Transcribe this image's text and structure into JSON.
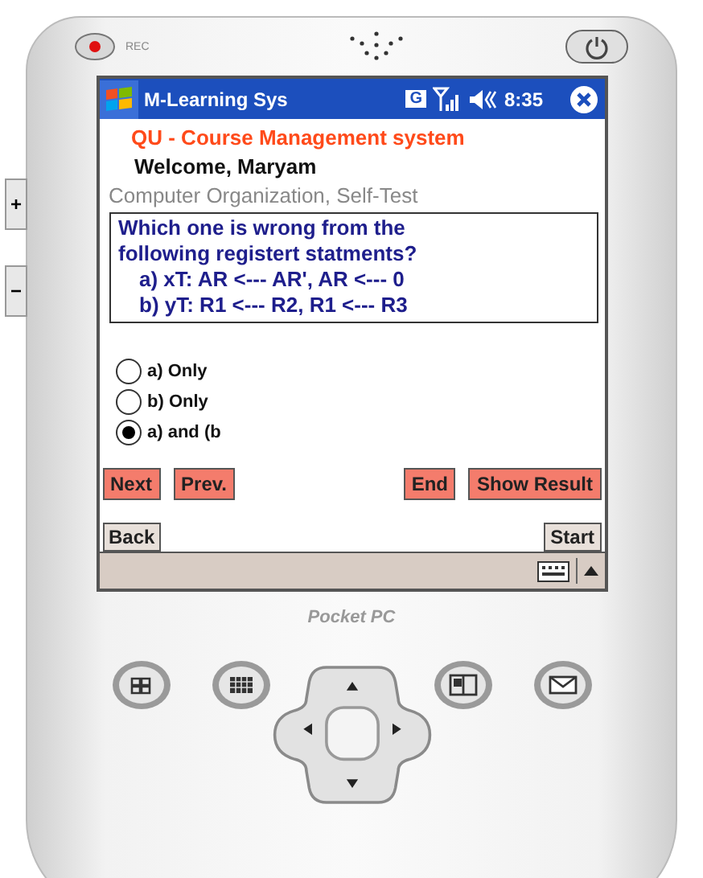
{
  "device": {
    "rec_label": "REC",
    "brand": "Pocket PC",
    "side_keys": [
      "+",
      "−"
    ]
  },
  "title_bar": {
    "title": "M-Learning Sys",
    "input_badge": "G",
    "time": "8:35"
  },
  "app_title": "QU - Course Management system",
  "welcome": "Welcome,  Maryam",
  "subtitle": "Computer Organization, Self-Test",
  "question": {
    "text": "Which one is wrong from the following registert statments?",
    "lines": [
      "a) xT: AR <--- AR',  AR <--- 0",
      "b) yT: R1 <--- R2,  R1 <--- R3"
    ]
  },
  "options": [
    {
      "label": "a) Only",
      "selected": false
    },
    {
      "label": "b) Only",
      "selected": false
    },
    {
      "label": "a) and (b",
      "selected": true
    }
  ],
  "buttons_left": [
    "Next",
    "Prev."
  ],
  "buttons_right": [
    "End",
    "Show Result"
  ],
  "softkeys": {
    "left": "Back",
    "right": "Start"
  }
}
